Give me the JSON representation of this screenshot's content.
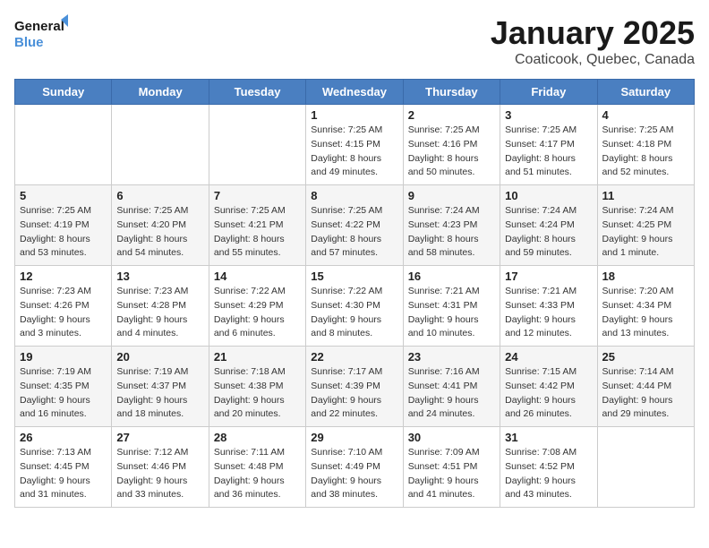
{
  "logo": {
    "line1": "General",
    "line2": "Blue"
  },
  "title": "January 2025",
  "subtitle": "Coaticook, Quebec, Canada",
  "weekdays": [
    "Sunday",
    "Monday",
    "Tuesday",
    "Wednesday",
    "Thursday",
    "Friday",
    "Saturday"
  ],
  "weeks": [
    [
      {
        "day": "",
        "info": ""
      },
      {
        "day": "",
        "info": ""
      },
      {
        "day": "",
        "info": ""
      },
      {
        "day": "1",
        "info": "Sunrise: 7:25 AM\nSunset: 4:15 PM\nDaylight: 8 hours\nand 49 minutes."
      },
      {
        "day": "2",
        "info": "Sunrise: 7:25 AM\nSunset: 4:16 PM\nDaylight: 8 hours\nand 50 minutes."
      },
      {
        "day": "3",
        "info": "Sunrise: 7:25 AM\nSunset: 4:17 PM\nDaylight: 8 hours\nand 51 minutes."
      },
      {
        "day": "4",
        "info": "Sunrise: 7:25 AM\nSunset: 4:18 PM\nDaylight: 8 hours\nand 52 minutes."
      }
    ],
    [
      {
        "day": "5",
        "info": "Sunrise: 7:25 AM\nSunset: 4:19 PM\nDaylight: 8 hours\nand 53 minutes."
      },
      {
        "day": "6",
        "info": "Sunrise: 7:25 AM\nSunset: 4:20 PM\nDaylight: 8 hours\nand 54 minutes."
      },
      {
        "day": "7",
        "info": "Sunrise: 7:25 AM\nSunset: 4:21 PM\nDaylight: 8 hours\nand 55 minutes."
      },
      {
        "day": "8",
        "info": "Sunrise: 7:25 AM\nSunset: 4:22 PM\nDaylight: 8 hours\nand 57 minutes."
      },
      {
        "day": "9",
        "info": "Sunrise: 7:24 AM\nSunset: 4:23 PM\nDaylight: 8 hours\nand 58 minutes."
      },
      {
        "day": "10",
        "info": "Sunrise: 7:24 AM\nSunset: 4:24 PM\nDaylight: 8 hours\nand 59 minutes."
      },
      {
        "day": "11",
        "info": "Sunrise: 7:24 AM\nSunset: 4:25 PM\nDaylight: 9 hours\nand 1 minute."
      }
    ],
    [
      {
        "day": "12",
        "info": "Sunrise: 7:23 AM\nSunset: 4:26 PM\nDaylight: 9 hours\nand 3 minutes."
      },
      {
        "day": "13",
        "info": "Sunrise: 7:23 AM\nSunset: 4:28 PM\nDaylight: 9 hours\nand 4 minutes."
      },
      {
        "day": "14",
        "info": "Sunrise: 7:22 AM\nSunset: 4:29 PM\nDaylight: 9 hours\nand 6 minutes."
      },
      {
        "day": "15",
        "info": "Sunrise: 7:22 AM\nSunset: 4:30 PM\nDaylight: 9 hours\nand 8 minutes."
      },
      {
        "day": "16",
        "info": "Sunrise: 7:21 AM\nSunset: 4:31 PM\nDaylight: 9 hours\nand 10 minutes."
      },
      {
        "day": "17",
        "info": "Sunrise: 7:21 AM\nSunset: 4:33 PM\nDaylight: 9 hours\nand 12 minutes."
      },
      {
        "day": "18",
        "info": "Sunrise: 7:20 AM\nSunset: 4:34 PM\nDaylight: 9 hours\nand 13 minutes."
      }
    ],
    [
      {
        "day": "19",
        "info": "Sunrise: 7:19 AM\nSunset: 4:35 PM\nDaylight: 9 hours\nand 16 minutes."
      },
      {
        "day": "20",
        "info": "Sunrise: 7:19 AM\nSunset: 4:37 PM\nDaylight: 9 hours\nand 18 minutes."
      },
      {
        "day": "21",
        "info": "Sunrise: 7:18 AM\nSunset: 4:38 PM\nDaylight: 9 hours\nand 20 minutes."
      },
      {
        "day": "22",
        "info": "Sunrise: 7:17 AM\nSunset: 4:39 PM\nDaylight: 9 hours\nand 22 minutes."
      },
      {
        "day": "23",
        "info": "Sunrise: 7:16 AM\nSunset: 4:41 PM\nDaylight: 9 hours\nand 24 minutes."
      },
      {
        "day": "24",
        "info": "Sunrise: 7:15 AM\nSunset: 4:42 PM\nDaylight: 9 hours\nand 26 minutes."
      },
      {
        "day": "25",
        "info": "Sunrise: 7:14 AM\nSunset: 4:44 PM\nDaylight: 9 hours\nand 29 minutes."
      }
    ],
    [
      {
        "day": "26",
        "info": "Sunrise: 7:13 AM\nSunset: 4:45 PM\nDaylight: 9 hours\nand 31 minutes."
      },
      {
        "day": "27",
        "info": "Sunrise: 7:12 AM\nSunset: 4:46 PM\nDaylight: 9 hours\nand 33 minutes."
      },
      {
        "day": "28",
        "info": "Sunrise: 7:11 AM\nSunset: 4:48 PM\nDaylight: 9 hours\nand 36 minutes."
      },
      {
        "day": "29",
        "info": "Sunrise: 7:10 AM\nSunset: 4:49 PM\nDaylight: 9 hours\nand 38 minutes."
      },
      {
        "day": "30",
        "info": "Sunrise: 7:09 AM\nSunset: 4:51 PM\nDaylight: 9 hours\nand 41 minutes."
      },
      {
        "day": "31",
        "info": "Sunrise: 7:08 AM\nSunset: 4:52 PM\nDaylight: 9 hours\nand 43 minutes."
      },
      {
        "day": "",
        "info": ""
      }
    ]
  ]
}
